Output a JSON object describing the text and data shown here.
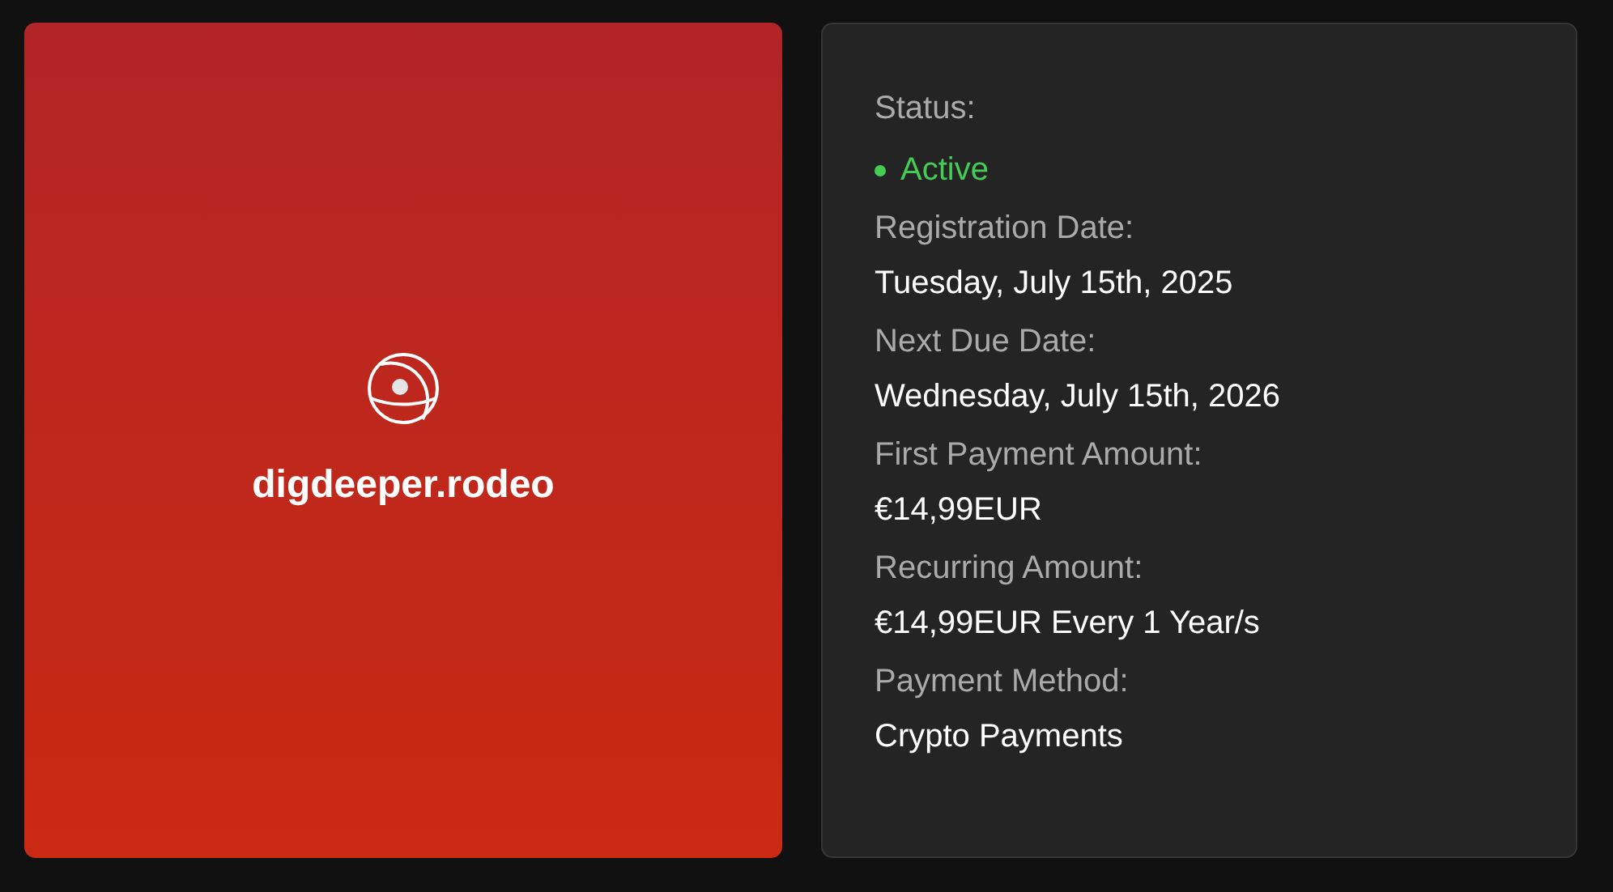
{
  "domain": {
    "name": "digdeeper.rodeo"
  },
  "status": {
    "label": "Status:",
    "value": "Active",
    "color": "#44cc55"
  },
  "fields": [
    {
      "label": "Registration Date:",
      "value": "Tuesday, July 15th, 2025"
    },
    {
      "label": "Next Due Date:",
      "value": "Wednesday, July 15th, 2026"
    },
    {
      "label": "First Payment Amount:",
      "value": "€14,99EUR"
    },
    {
      "label": "Recurring Amount:",
      "value": "€14,99EUR Every 1 Year/s"
    },
    {
      "label": "Payment Method:",
      "value": "Crypto Payments"
    }
  ]
}
